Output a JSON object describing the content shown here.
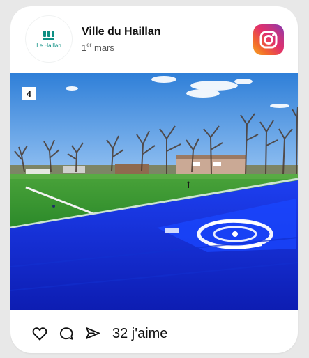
{
  "post": {
    "account_name": "Ville du Haillan",
    "logo_text": "Le Haillan",
    "date_day": "1",
    "date_sup": "er",
    "date_month": "mars",
    "photo_badge": "4",
    "likes_text": "32 j'aime"
  },
  "icons": {
    "platform": "instagram-icon",
    "like": "heart-icon",
    "comment": "comment-bubble-icon",
    "share": "paper-plane-icon"
  },
  "colors": {
    "brand_teal": "#0d8f83",
    "card_bg": "#ffffff",
    "page_bg": "#e8e8e8"
  }
}
